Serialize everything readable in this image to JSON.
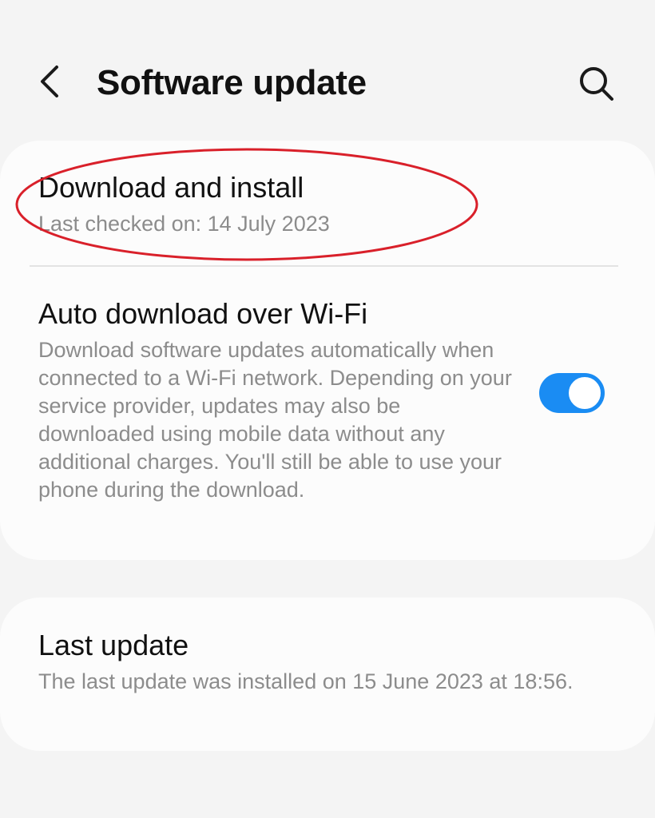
{
  "header": {
    "title": "Software update",
    "back_icon": "chevron-left-icon",
    "search_icon": "search-icon"
  },
  "download_install": {
    "title": "Download and install",
    "subtitle": "Last checked on: 14 July 2023"
  },
  "auto_download": {
    "title": "Auto download over Wi-Fi",
    "description": "Download software updates automatically when connected to a Wi-Fi network. Depending on your service provider, updates may also be downloaded using mobile data without any additional charges. You'll still be able to use your phone during the download.",
    "toggle_on": true
  },
  "last_update": {
    "title": "Last update",
    "description": "The last update was installed on 15 June 2023 at 18:56."
  },
  "colors": {
    "background": "#f4f4f4",
    "card": "#fcfcfc",
    "accent": "#1a8cf3",
    "annotation": "#d9202a",
    "secondary_text": "#8c8c8c"
  }
}
